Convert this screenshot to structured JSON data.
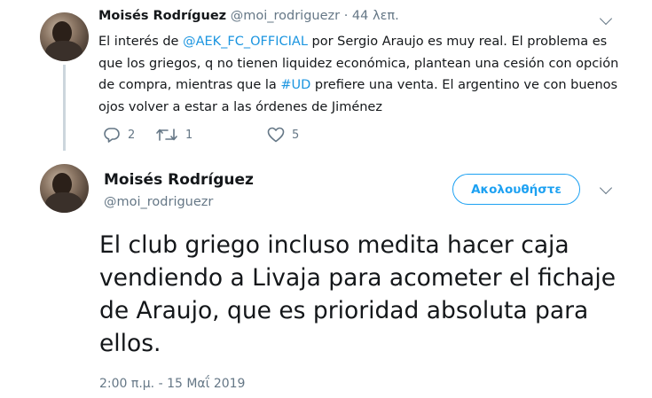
{
  "tweet_reply": {
    "name": "Moisés Rodríguez",
    "handle": "@moi_rodriguezr",
    "separator": " · ",
    "time_ago": "44 λεπ.",
    "text": {
      "p1": "El interés de ",
      "mention": "@AEK_FC_OFFICIAL",
      "p2": " por Sergio Araujo es muy real. El problema es que los griegos, q no tienen liquidez económica, plantean una cesión con opción de compra, mientras que la ",
      "hashtag": "#UD",
      "p3": " prefiere una venta. El argentino ve con buenos ojos volver a estar a las órdenes de Jiménez"
    },
    "actions": {
      "replies": "2",
      "retweets": "1",
      "likes": "5"
    }
  },
  "tweet_main": {
    "name": "Moisés Rodríguez",
    "handle": "@moi_rodriguezr",
    "follow_label": "Ακολουθήστε",
    "text": "El club griego incluso medita hacer caja vendiendo a Livaja para acometer el fichaje de Araujo, que es prioridad absoluta para ellos.",
    "timestamp": "2:00 π.μ. - 15 Μαΐ 2019"
  },
  "icons": {
    "reply": "reply-icon",
    "retweet": "retweet-icon",
    "like": "heart-icon",
    "menu": "chevron-down-icon"
  },
  "colors": {
    "link": "#1b95e0",
    "accent": "#1da1f2",
    "muted": "#657786",
    "thread_line": "#ccd6dd"
  }
}
